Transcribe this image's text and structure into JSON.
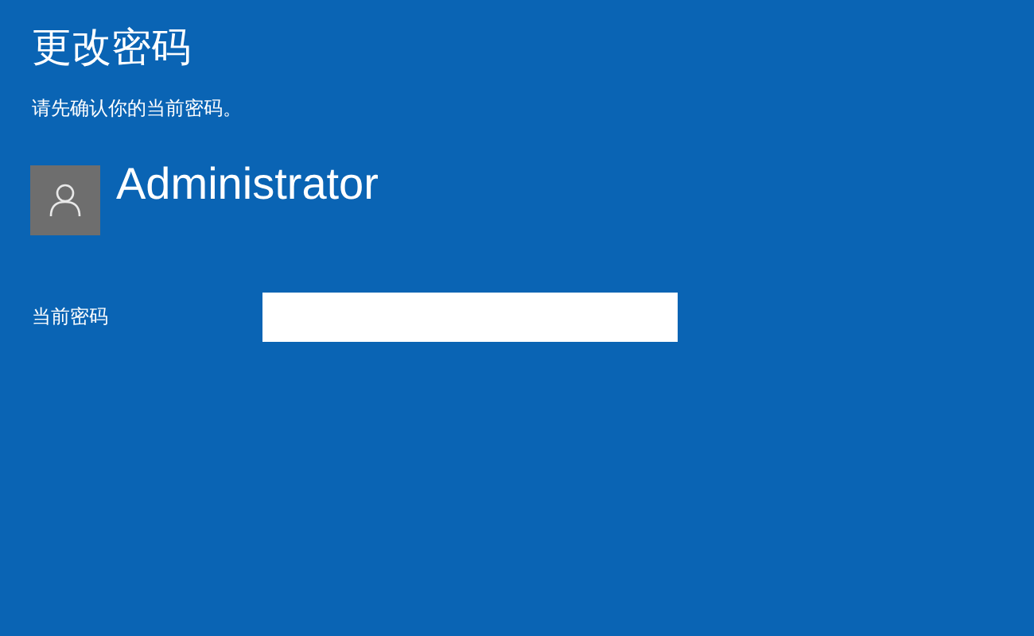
{
  "title": "更改密码",
  "subtitle": "请先确认你的当前密码。",
  "account": {
    "name": "Administrator"
  },
  "fields": [
    {
      "label": "当前密码"
    }
  ]
}
